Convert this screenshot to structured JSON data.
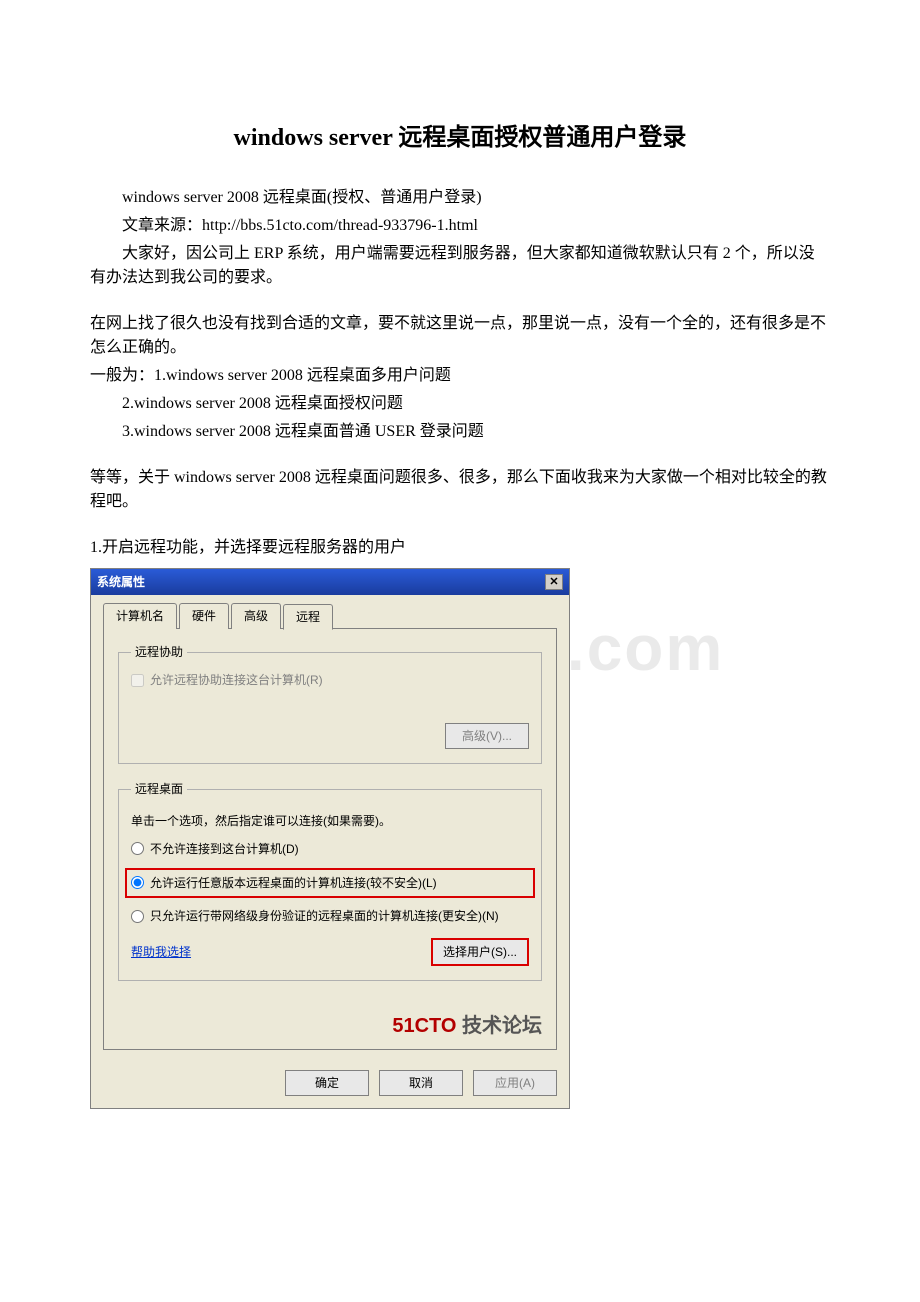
{
  "article": {
    "title": "windows server 远程桌面授权普通用户登录",
    "subtitle": "windows server 2008 远程桌面(授权、普通用户登录)",
    "source_line": "文章来源：http://bbs.51cto.com/thread-933796-1.html",
    "p1": "大家好，因公司上 ERP 系统，用户端需要远程到服务器，但大家都知道微软默认只有 2 个，所以没有办法达到我公司的要求。",
    "p2": "在网上找了很久也没有找到合适的文章，要不就这里说一点，那里说一点，没有一个全的，还有很多是不怎么正确的。",
    "p3_prefix": "一般为：",
    "list": {
      "i1": "1.windows server 2008 远程桌面多用户问题",
      "i2": "2.windows server 2008 远程桌面授权问题",
      "i3": "3.windows server 2008 远程桌面普通 USER 登录问题"
    },
    "p4": "等等，关于 windows server 2008 远程桌面问题很多、很多，那么下面收我来为大家做一个相对比较全的教程吧。",
    "step1": "1.开启远程功能，并选择要远程服务器的用户"
  },
  "watermark": "www.bdocx.com",
  "dialog": {
    "title": "系统属性",
    "close_glyph": "✕",
    "tabs": {
      "t1": "计算机名",
      "t2": "硬件",
      "t3": "高级",
      "t4": "远程"
    },
    "group1": {
      "legend": "远程协助",
      "checkbox": "允许远程协助连接这台计算机(R)",
      "advanced_btn": "高级(V)..."
    },
    "group2": {
      "legend": "远程桌面",
      "instruction": "单击一个选项，然后指定谁可以连接(如果需要)。",
      "r1": "不允许连接到这台计算机(D)",
      "r2": "允许运行任意版本远程桌面的计算机连接(较不安全)(L)",
      "r3": "只允许运行带网络级身份验证的远程桌面的计算机连接(更安全)(N)",
      "help_link": "帮助我选择",
      "select_user_btn": "选择用户(S)..."
    },
    "branding_left": "51CTO",
    "branding_right": "技术论坛",
    "footer": {
      "ok": "确定",
      "cancel": "取消",
      "apply": "应用(A)"
    }
  }
}
